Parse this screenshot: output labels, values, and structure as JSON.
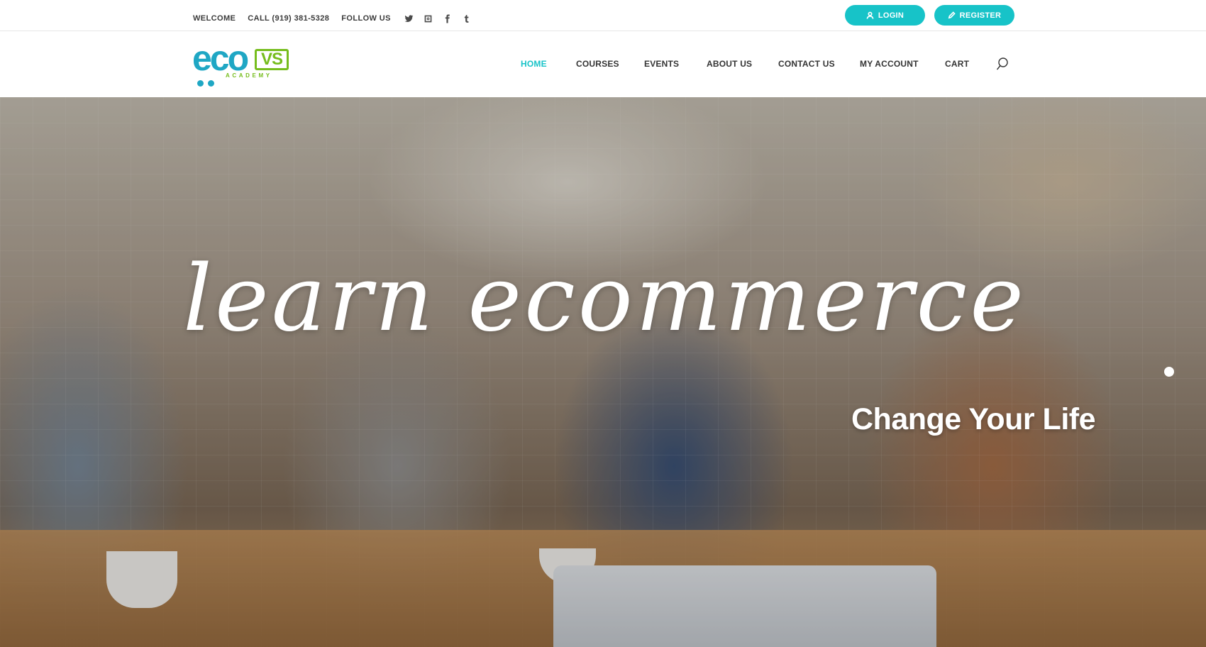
{
  "topbar": {
    "welcome": "WELCOME",
    "call": "CALL (919) 381-5328",
    "follow": "FOLLOW US",
    "social": [
      "twitter-icon",
      "instagram-icon",
      "facebook-icon",
      "tumblr-icon"
    ],
    "login_label": "LOGIN",
    "register_label": "REGISTER"
  },
  "logo": {
    "main": "eco",
    "badge": "VS",
    "sub": "ACADEMY"
  },
  "nav": {
    "items": [
      "HOME",
      "COURSES",
      "EVENTS",
      "ABOUT US",
      "CONTACT US",
      "MY ACCOUNT",
      "CART"
    ],
    "active": "HOME"
  },
  "hero": {
    "headline": "learn ecommerce",
    "tagline": "Change Your Life"
  },
  "colors": {
    "accent": "#17c3c8",
    "logo_blue": "#1fa7c4",
    "logo_green": "#76bd1d"
  }
}
